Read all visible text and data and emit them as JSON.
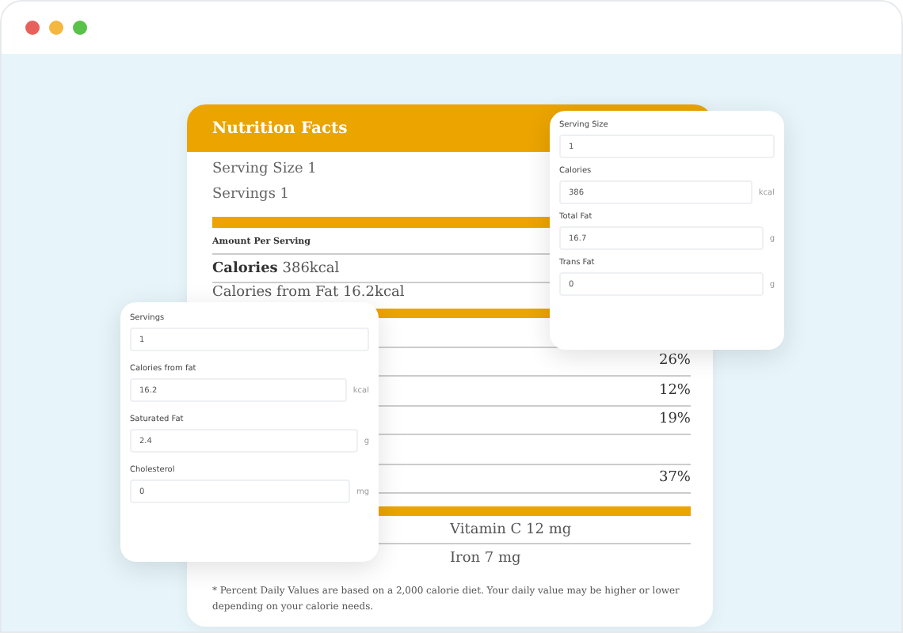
{
  "label": {
    "title": "Nutrition Facts",
    "serving_size": "Serving Size 1",
    "servings": "Servings 1",
    "amount_heading": "Amount Per Serving",
    "calories": "**Calories** 386kcal",
    "calories_from_fat": "Calories from Fat 16.2kcal",
    "daily_rows": [
      {
        "kind": "blank"
      },
      {
        "kind": "value",
        "percent": "26%"
      },
      {
        "kind": "value",
        "percent": "12%"
      },
      {
        "kind": "value",
        "percent": "19%"
      },
      {
        "kind": "blank"
      },
      {
        "kind": "value",
        "percent": "37%"
      }
    ],
    "vitamins": [
      "Vitamin C 12 mg",
      "Iron 7 mg"
    ],
    "footnote": "* Percent Daily Values are based on a 2,000 calorie diet. Your daily value may be higher or lower depending on your calorie needs."
  },
  "form_right": {
    "fields": [
      {
        "label": "Serving Size",
        "value": "1"
      },
      {
        "label": "Calories",
        "value": "386",
        "unit": "kcal"
      },
      {
        "label": "Total Fat",
        "value": "16.7",
        "unit": "g"
      },
      {
        "label": "Trans Fat",
        "value": "0",
        "unit": "g"
      }
    ]
  },
  "form_left": {
    "fields": [
      {
        "label": "Servings",
        "value": "1"
      },
      {
        "label": "Calories from fat",
        "value": "16.2",
        "unit": "kcal"
      },
      {
        "label": "Saturated Fat",
        "value": "2.4",
        "unit": "g"
      },
      {
        "label": "Cholesterol",
        "value": "0",
        "unit": "mg"
      }
    ]
  }
}
